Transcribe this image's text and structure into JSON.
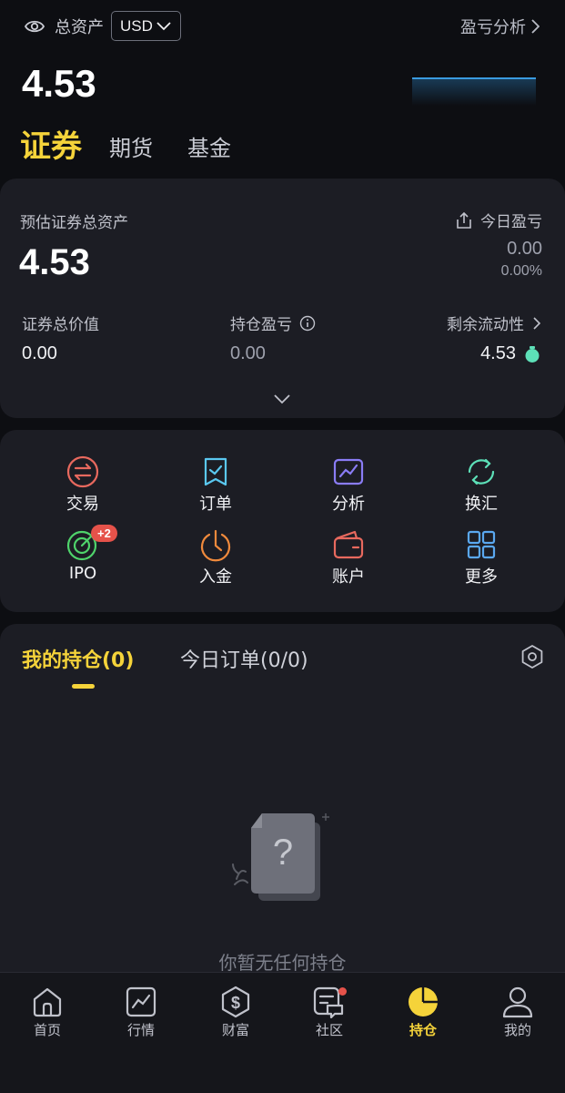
{
  "header": {
    "total_assets_label": "总资产",
    "currency": "USD",
    "pnl_analysis_link": "盈亏分析",
    "total_assets_value": "4.53"
  },
  "asset_tabs": [
    {
      "label": "证券",
      "active": true
    },
    {
      "label": "期货",
      "active": false
    },
    {
      "label": "基金",
      "active": false
    }
  ],
  "summary": {
    "estimated_label": "预估证券总资产",
    "estimated_value": "4.53",
    "today_pnl_label": "今日盈亏",
    "today_pnl_value": "0.00",
    "today_pnl_pct": "0.00%",
    "market_value_label": "证券总价值",
    "market_value": "0.00",
    "position_pnl_label": "持仓盈亏",
    "position_pnl_value": "0.00",
    "liquidity_label": "剩余流动性",
    "liquidity_value": "4.53"
  },
  "actions": [
    {
      "label": "交易",
      "icon": "trade-exchange-icon",
      "color": "#e8695e"
    },
    {
      "label": "订单",
      "icon": "order-check-icon",
      "color": "#5ac8f0"
    },
    {
      "label": "分析",
      "icon": "analysis-chart-icon",
      "color": "#8a7cf5"
    },
    {
      "label": "换汇",
      "icon": "currency-exchange-icon",
      "color": "#5de0b8"
    },
    {
      "label": "IPO",
      "icon": "ipo-target-icon",
      "color": "#4fd36b",
      "badge": "+2"
    },
    {
      "label": "入金",
      "icon": "deposit-clock-icon",
      "color": "#f08a3c"
    },
    {
      "label": "账户",
      "icon": "wallet-icon",
      "color": "#e8695e"
    },
    {
      "label": "更多",
      "icon": "grid-more-icon",
      "color": "#5aa8f0"
    }
  ],
  "positions": {
    "holdings_tab": "我的持仓(0)",
    "orders_tab": "今日订单(0/0)",
    "empty_text": "你暂无任何持仓"
  },
  "nav": [
    {
      "label": "首页",
      "icon": "home-icon"
    },
    {
      "label": "行情",
      "icon": "market-chart-icon"
    },
    {
      "label": "财富",
      "icon": "wealth-dollar-icon"
    },
    {
      "label": "社区",
      "icon": "community-chat-icon",
      "dot": true
    },
    {
      "label": "持仓",
      "icon": "positions-pie-icon",
      "active": true
    },
    {
      "label": "我的",
      "icon": "profile-icon"
    }
  ],
  "colors": {
    "accent": "#f5d33a",
    "background": "#0d0e12",
    "card": "#1c1d24",
    "liquidity_indicator": "#5de0b8",
    "alert": "#e5524a"
  }
}
